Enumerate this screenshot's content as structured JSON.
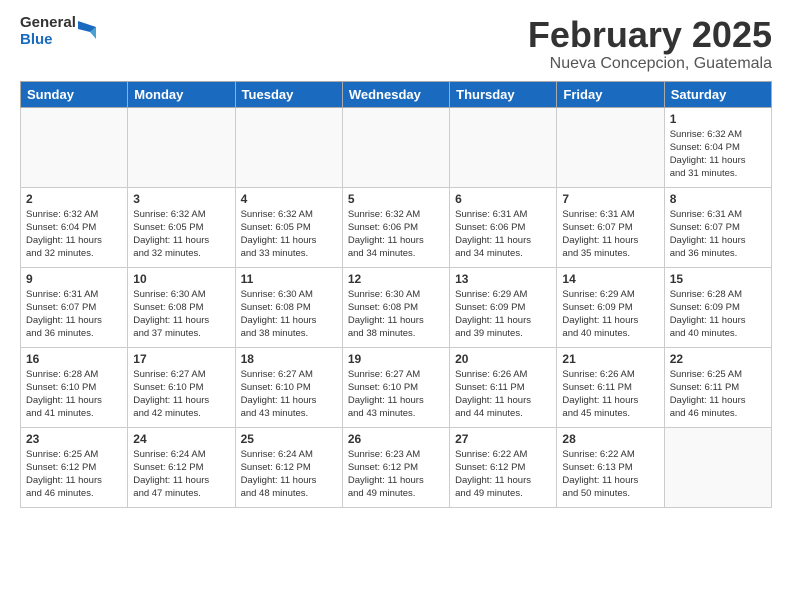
{
  "logo": {
    "general": "General",
    "blue": "Blue"
  },
  "title": "February 2025",
  "subtitle": "Nueva Concepcion, Guatemala",
  "weekdays": [
    "Sunday",
    "Monday",
    "Tuesday",
    "Wednesday",
    "Thursday",
    "Friday",
    "Saturday"
  ],
  "weeks": [
    [
      {
        "day": "",
        "info": ""
      },
      {
        "day": "",
        "info": ""
      },
      {
        "day": "",
        "info": ""
      },
      {
        "day": "",
        "info": ""
      },
      {
        "day": "",
        "info": ""
      },
      {
        "day": "",
        "info": ""
      },
      {
        "day": "1",
        "info": "Sunrise: 6:32 AM\nSunset: 6:04 PM\nDaylight: 11 hours\nand 31 minutes."
      }
    ],
    [
      {
        "day": "2",
        "info": "Sunrise: 6:32 AM\nSunset: 6:04 PM\nDaylight: 11 hours\nand 32 minutes."
      },
      {
        "day": "3",
        "info": "Sunrise: 6:32 AM\nSunset: 6:05 PM\nDaylight: 11 hours\nand 32 minutes."
      },
      {
        "day": "4",
        "info": "Sunrise: 6:32 AM\nSunset: 6:05 PM\nDaylight: 11 hours\nand 33 minutes."
      },
      {
        "day": "5",
        "info": "Sunrise: 6:32 AM\nSunset: 6:06 PM\nDaylight: 11 hours\nand 34 minutes."
      },
      {
        "day": "6",
        "info": "Sunrise: 6:31 AM\nSunset: 6:06 PM\nDaylight: 11 hours\nand 34 minutes."
      },
      {
        "day": "7",
        "info": "Sunrise: 6:31 AM\nSunset: 6:07 PM\nDaylight: 11 hours\nand 35 minutes."
      },
      {
        "day": "8",
        "info": "Sunrise: 6:31 AM\nSunset: 6:07 PM\nDaylight: 11 hours\nand 36 minutes."
      }
    ],
    [
      {
        "day": "9",
        "info": "Sunrise: 6:31 AM\nSunset: 6:07 PM\nDaylight: 11 hours\nand 36 minutes."
      },
      {
        "day": "10",
        "info": "Sunrise: 6:30 AM\nSunset: 6:08 PM\nDaylight: 11 hours\nand 37 minutes."
      },
      {
        "day": "11",
        "info": "Sunrise: 6:30 AM\nSunset: 6:08 PM\nDaylight: 11 hours\nand 38 minutes."
      },
      {
        "day": "12",
        "info": "Sunrise: 6:30 AM\nSunset: 6:08 PM\nDaylight: 11 hours\nand 38 minutes."
      },
      {
        "day": "13",
        "info": "Sunrise: 6:29 AM\nSunset: 6:09 PM\nDaylight: 11 hours\nand 39 minutes."
      },
      {
        "day": "14",
        "info": "Sunrise: 6:29 AM\nSunset: 6:09 PM\nDaylight: 11 hours\nand 40 minutes."
      },
      {
        "day": "15",
        "info": "Sunrise: 6:28 AM\nSunset: 6:09 PM\nDaylight: 11 hours\nand 40 minutes."
      }
    ],
    [
      {
        "day": "16",
        "info": "Sunrise: 6:28 AM\nSunset: 6:10 PM\nDaylight: 11 hours\nand 41 minutes."
      },
      {
        "day": "17",
        "info": "Sunrise: 6:27 AM\nSunset: 6:10 PM\nDaylight: 11 hours\nand 42 minutes."
      },
      {
        "day": "18",
        "info": "Sunrise: 6:27 AM\nSunset: 6:10 PM\nDaylight: 11 hours\nand 43 minutes."
      },
      {
        "day": "19",
        "info": "Sunrise: 6:27 AM\nSunset: 6:10 PM\nDaylight: 11 hours\nand 43 minutes."
      },
      {
        "day": "20",
        "info": "Sunrise: 6:26 AM\nSunset: 6:11 PM\nDaylight: 11 hours\nand 44 minutes."
      },
      {
        "day": "21",
        "info": "Sunrise: 6:26 AM\nSunset: 6:11 PM\nDaylight: 11 hours\nand 45 minutes."
      },
      {
        "day": "22",
        "info": "Sunrise: 6:25 AM\nSunset: 6:11 PM\nDaylight: 11 hours\nand 46 minutes."
      }
    ],
    [
      {
        "day": "23",
        "info": "Sunrise: 6:25 AM\nSunset: 6:12 PM\nDaylight: 11 hours\nand 46 minutes."
      },
      {
        "day": "24",
        "info": "Sunrise: 6:24 AM\nSunset: 6:12 PM\nDaylight: 11 hours\nand 47 minutes."
      },
      {
        "day": "25",
        "info": "Sunrise: 6:24 AM\nSunset: 6:12 PM\nDaylight: 11 hours\nand 48 minutes."
      },
      {
        "day": "26",
        "info": "Sunrise: 6:23 AM\nSunset: 6:12 PM\nDaylight: 11 hours\nand 49 minutes."
      },
      {
        "day": "27",
        "info": "Sunrise: 6:22 AM\nSunset: 6:12 PM\nDaylight: 11 hours\nand 49 minutes."
      },
      {
        "day": "28",
        "info": "Sunrise: 6:22 AM\nSunset: 6:13 PM\nDaylight: 11 hours\nand 50 minutes."
      },
      {
        "day": "",
        "info": ""
      }
    ]
  ]
}
